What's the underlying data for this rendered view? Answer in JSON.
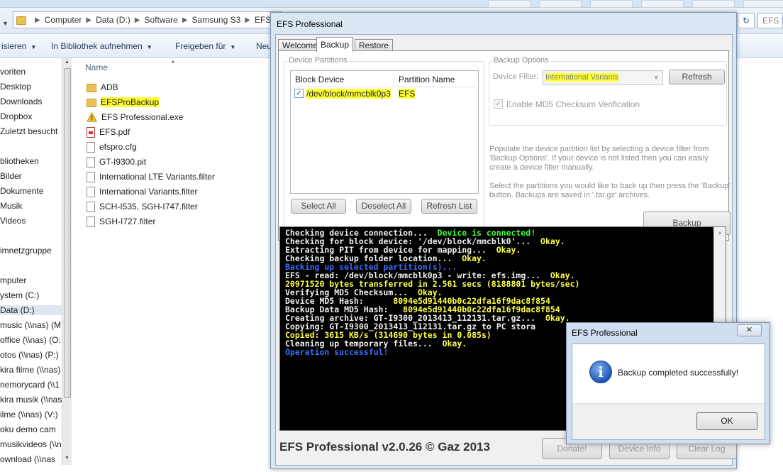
{
  "explorer": {
    "breadcrumb": [
      "Computer",
      "Data (D:)",
      "Software",
      "Samsung S3",
      "EFS"
    ],
    "search_placeholder": "EFS B",
    "commands": [
      "isieren",
      "In Bibliothek aufnehmen",
      "Freigeben für",
      "Neu"
    ],
    "nav_items": [
      "voriten",
      "Desktop",
      "Downloads",
      "Dropbox",
      "Zuletzt besucht",
      "bliotheken",
      "Bilder",
      "Dokumente",
      "Musik",
      "Videos",
      "imnetzgruppe",
      "mputer",
      "ystem (C:)",
      "Data (D:)",
      "music (\\\\nas) (M",
      "office (\\\\nas) (O:",
      "otos (\\\\nas) (P:)",
      "kira filme (\\\\nas)",
      "nemorycard (\\\\1",
      "kira musik (\\\\nas",
      "ilme (\\\\nas) (V:)",
      "oku demo cam",
      "musikvideos (\\\\n",
      "ownload (\\\\nas"
    ],
    "column_header": "Name",
    "files": [
      {
        "name": "ADB",
        "icon": "folder"
      },
      {
        "name": "EFSProBackup",
        "icon": "folder"
      },
      {
        "name": "EFS Professional.exe",
        "icon": "warning"
      },
      {
        "name": "EFS.pdf",
        "icon": "pdf"
      },
      {
        "name": "efspro.cfg",
        "icon": "doc"
      },
      {
        "name": "GT-I9300.pit",
        "icon": "doc"
      },
      {
        "name": "International LTE Variants.filter",
        "icon": "doc"
      },
      {
        "name": "International Variants.filter",
        "icon": "doc"
      },
      {
        "name": "SCH-I535, SGH-I747.filter",
        "icon": "doc"
      },
      {
        "name": "SGH-I727.filter",
        "icon": "doc"
      }
    ]
  },
  "efs": {
    "title": "EFS Professional",
    "tabs": [
      "Welcome",
      "Backup",
      "Restore"
    ],
    "active_tab": "Backup",
    "partitions": {
      "group_label": "Device Partitions",
      "col_block": "Block Device",
      "col_name": "Partition Name",
      "rows": [
        {
          "block": "/dev/block/mmcblk0p3",
          "name": "EFS",
          "checked": true
        }
      ],
      "select_all": "Select All",
      "deselect_all": "Deselect All",
      "refresh_list": "Refresh List"
    },
    "options": {
      "group_label": "Backup Options",
      "filter_label": "Device Filter:",
      "filter_value": "International Variants",
      "refresh": "Refresh",
      "md5_label": "Enable MD5 Checksum Verification",
      "md5_checked": true
    },
    "note1": "Populate the device partition list by selecting a device filter from 'Backup Options'. If your device is not listed then you can easily create a device filter manually.",
    "note2": "Select the partitions you would like to back up then press the 'Backup' button. Backups are saved in '.tar.gz' archives.",
    "backup_button": "Backup",
    "console_lines": [
      [
        {
          "t": "Checking device connection...  ",
          "c": "w"
        },
        {
          "t": "Device is connected!",
          "c": "g"
        }
      ],
      [
        {
          "t": "Checking for block device: '/dev/block/mmcblk0'...  ",
          "c": "w"
        },
        {
          "t": "Okay.",
          "c": "y"
        }
      ],
      [
        {
          "t": "Extracting PIT from device for mapping...  ",
          "c": "w"
        },
        {
          "t": "Okay.",
          "c": "y"
        }
      ],
      [
        {
          "t": "Checking backup folder location...  ",
          "c": "w"
        },
        {
          "t": "Okay.",
          "c": "y"
        }
      ],
      [
        {
          "t": "Backing up selected partition(s)...",
          "c": "b"
        }
      ],
      [
        {
          "t": "EFS - read: /dev/block/mmcblk0p3 - write: efs.img...  ",
          "c": "w"
        },
        {
          "t": "Okay.",
          "c": "y"
        }
      ],
      [
        {
          "t": "20971520 bytes transferred in 2.561 secs (8188801 bytes/sec)",
          "c": "y"
        }
      ],
      [
        {
          "t": "Verifying MD5 Checksum...  ",
          "c": "w"
        },
        {
          "t": "Okay.",
          "c": "y"
        }
      ],
      [
        {
          "t": "Device MD5 Hash:      ",
          "c": "w"
        },
        {
          "t": "8094e5d91440b0c22dfa16f9dac8f854",
          "c": "y"
        }
      ],
      [
        {
          "t": "Backup Data MD5 Hash:   ",
          "c": "w"
        },
        {
          "t": "8094e5d91440b0c22dfa16f9dac8f854",
          "c": "y"
        }
      ],
      [
        {
          "t": "Creating archive: GT-I9300_2013413_112131.tar.gz...  ",
          "c": "w"
        },
        {
          "t": "Okay.",
          "c": "y"
        }
      ],
      [
        {
          "t": "Copying: GT-I9300_2013413_112131.tar.gz to PC stora",
          "c": "w"
        }
      ],
      [
        {
          "t": "Copied: 3615 KB/s (314690 bytes in 0.085s)",
          "c": "y"
        }
      ],
      [
        {
          "t": "Cleaning up temporary files...  ",
          "c": "w"
        },
        {
          "t": "Okay.",
          "c": "y"
        }
      ],
      [
        {
          "t": "Operation successful!",
          "c": "b"
        }
      ]
    ],
    "footer": "EFS Professional v2.0.26 © Gaz 2013",
    "donate": "Donate!",
    "device_info": "Device Info",
    "clear_log": "Clear Log"
  },
  "dialog": {
    "title": "EFS Professional",
    "close": "✕",
    "message": "Backup completed successfully!",
    "ok": "OK",
    "icon": "info-icon"
  }
}
